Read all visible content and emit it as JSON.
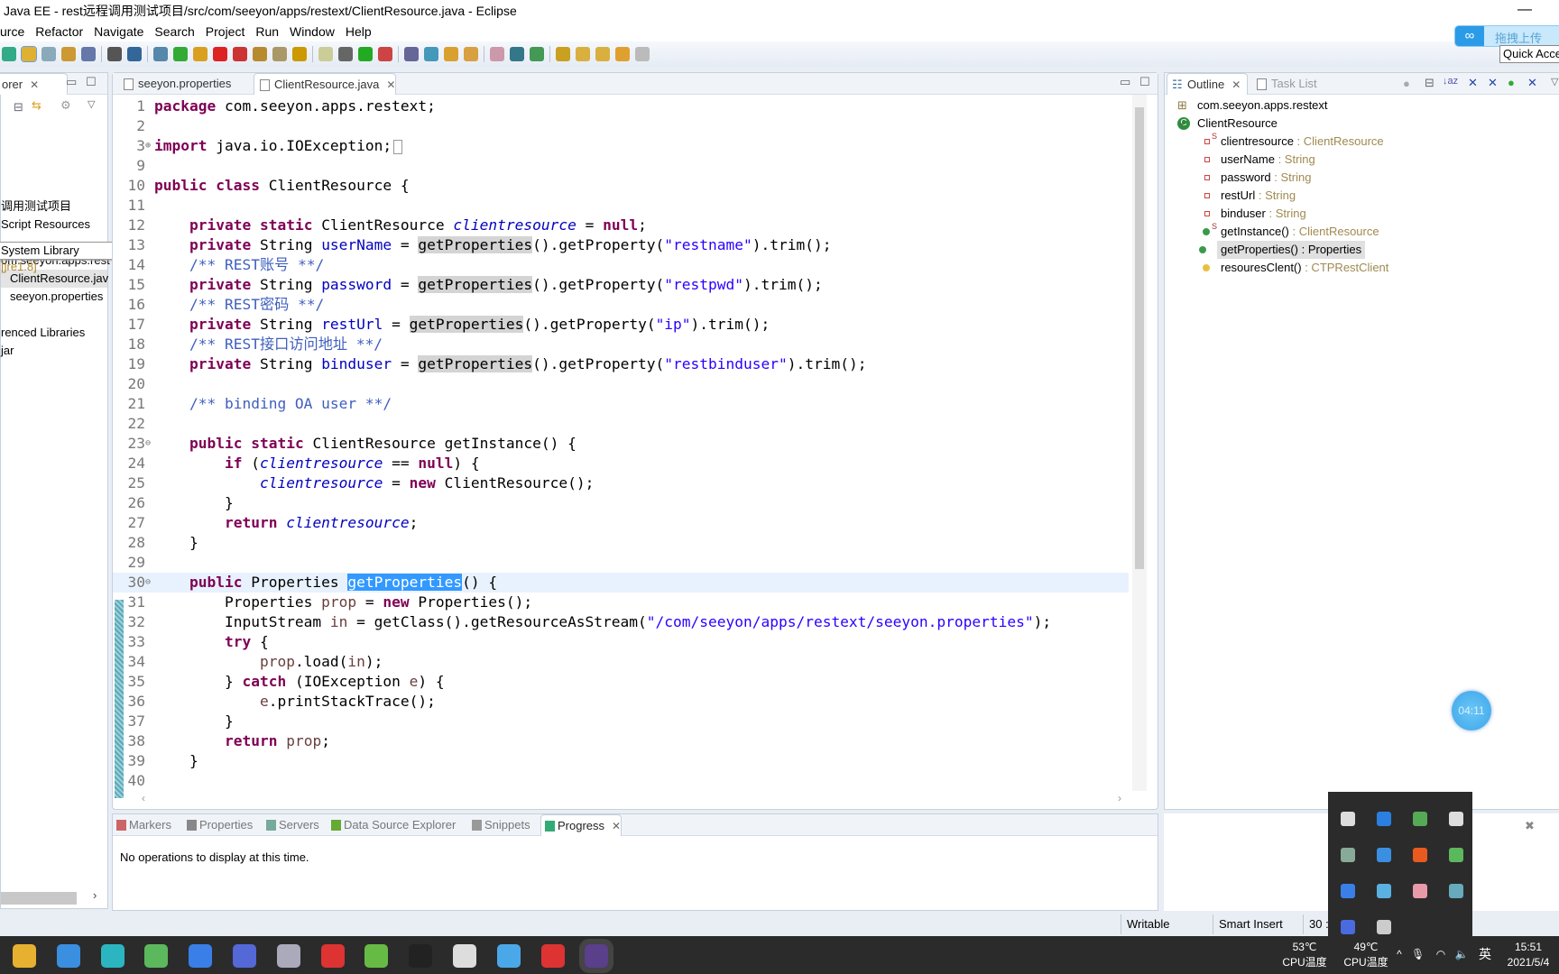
{
  "window": {
    "title": "Java EE - rest远程调用测试项目/src/com/seeyon/apps/restext/ClientResource.java - Eclipse",
    "minimize": "—"
  },
  "menu": [
    "urce",
    "Refactor",
    "Navigate",
    "Search",
    "Project",
    "Run",
    "Window",
    "Help"
  ],
  "toolbar_icons": [
    "pin-icon",
    "brush-icon",
    "link-icon",
    "doc-icon",
    "list-icon",
    "pilcrow-icon",
    "monitor-icon",
    "pen-icon",
    "resume-icon",
    "suspend-icon",
    "terminate-icon",
    "disconnect-icon",
    "step-into-icon",
    "step-over-icon",
    "step-return-icon",
    "drop-frame-icon",
    "bug-icon",
    "run-icon",
    "external-tools-icon",
    "new-server-icon",
    "new-class-icon",
    "open-folder-icon",
    "open-type-icon",
    "edit-icon",
    "globe-icon",
    "search-icon",
    "next-annotation-icon",
    "prev-annotation-icon",
    "last-edit-icon",
    "back-icon",
    "forward-icon"
  ],
  "toolbar_colors": [
    "#3a8",
    "#e0b030",
    "#8ab",
    "#c93",
    "#67a",
    "#555",
    "#369",
    "#58a",
    "#3a3",
    "#d9a020",
    "#d22",
    "#c33",
    "#b88a30",
    "#a96",
    "#c90",
    "#cc9",
    "#666",
    "#2a2",
    "#c44",
    "#669",
    "#49b",
    "#d9a030",
    "#d8a040",
    "#c9a",
    "#378",
    "#495",
    "#c9a020",
    "#d9b040",
    "#d9b040",
    "#e0a030",
    "#bbb"
  ],
  "baidu": {
    "label": "拖拽上传",
    "icon": "cloud-icon"
  },
  "quick_access": "Quick Acce",
  "explorer": {
    "tab": "orer",
    "items": [
      "调用测试项目",
      "Script Resources",
      "om.seeyon.apps.rest",
      "ClientResource.jav",
      "seeyon.properties",
      "System Library",
      "renced Libraries",
      "jar"
    ],
    "tooltip_main": "System Library",
    "tooltip_extra": "[jre1.8]"
  },
  "editor": {
    "tabs": [
      {
        "label": "seeyon.properties"
      },
      {
        "label": "ClientResource.java"
      }
    ],
    "lines": [
      {
        "n": "1",
        "t": [
          [
            "kw",
            "package"
          ],
          [
            "p",
            " com.seeyon.apps.restext;"
          ]
        ]
      },
      {
        "n": "2",
        "t": []
      },
      {
        "n": "3",
        "t": [
          [
            "kw",
            "import"
          ],
          [
            "p",
            " java.io.IOException;"
          ]
        ]
      },
      {
        "n": "9",
        "t": []
      },
      {
        "n": "10",
        "t": [
          [
            "kw",
            "public"
          ],
          [
            "p",
            " "
          ],
          [
            "kw",
            "class"
          ],
          [
            "p",
            " ClientResource {"
          ]
        ]
      },
      {
        "n": "11",
        "t": []
      },
      {
        "n": "12",
        "t": [
          [
            "p",
            "    "
          ],
          [
            "kw",
            "private"
          ],
          [
            "p",
            " "
          ],
          [
            "kw",
            "static"
          ],
          [
            "p",
            " ClientResource "
          ],
          [
            "sf",
            "clientresource"
          ],
          [
            "p",
            " = "
          ],
          [
            "kw",
            "null"
          ],
          [
            "p",
            ";"
          ]
        ]
      },
      {
        "n": "13",
        "t": [
          [
            "p",
            "    "
          ],
          [
            "kw",
            "private"
          ],
          [
            "p",
            " String "
          ],
          [
            "fd",
            "userName"
          ],
          [
            "p",
            " = "
          ],
          [
            "hl",
            "getProperties"
          ],
          [
            "p",
            "().getProperty("
          ],
          [
            "st",
            "\"restname\""
          ],
          [
            "p",
            ").trim();"
          ]
        ]
      },
      {
        "n": "14",
        "t": [
          [
            "cm",
            "    /** REST账号 **/"
          ]
        ]
      },
      {
        "n": "15",
        "t": [
          [
            "p",
            "    "
          ],
          [
            "kw",
            "private"
          ],
          [
            "p",
            " String "
          ],
          [
            "fd",
            "password"
          ],
          [
            "p",
            " = "
          ],
          [
            "hl",
            "getProperties"
          ],
          [
            "p",
            "().getProperty("
          ],
          [
            "st",
            "\"restpwd\""
          ],
          [
            "p",
            ").trim();"
          ]
        ]
      },
      {
        "n": "16",
        "t": [
          [
            "cm",
            "    /** REST密码 **/"
          ]
        ]
      },
      {
        "n": "17",
        "t": [
          [
            "p",
            "    "
          ],
          [
            "kw",
            "private"
          ],
          [
            "p",
            " String "
          ],
          [
            "fd",
            "restUrl"
          ],
          [
            "p",
            " = "
          ],
          [
            "hl",
            "getProperties"
          ],
          [
            "p",
            "().getProperty("
          ],
          [
            "st",
            "\"ip\""
          ],
          [
            "p",
            ").trim();"
          ]
        ]
      },
      {
        "n": "18",
        "t": [
          [
            "cm",
            "    /** REST接口访问地址 **/"
          ]
        ]
      },
      {
        "n": "19",
        "t": [
          [
            "p",
            "    "
          ],
          [
            "kw",
            "private"
          ],
          [
            "p",
            " String "
          ],
          [
            "fd",
            "binduser"
          ],
          [
            "p",
            " = "
          ],
          [
            "hl",
            "getProperties"
          ],
          [
            "p",
            "().getProperty("
          ],
          [
            "st",
            "\"restbinduser\""
          ],
          [
            "p",
            ").trim();"
          ]
        ]
      },
      {
        "n": "20",
        "t": []
      },
      {
        "n": "21",
        "t": [
          [
            "cm",
            "    /** binding OA user **/"
          ]
        ]
      },
      {
        "n": "22",
        "t": []
      },
      {
        "n": "23",
        "t": [
          [
            "p",
            "    "
          ],
          [
            "kw",
            "public"
          ],
          [
            "p",
            " "
          ],
          [
            "kw",
            "static"
          ],
          [
            "p",
            " ClientResource getInstance() {"
          ]
        ]
      },
      {
        "n": "24",
        "t": [
          [
            "p",
            "        "
          ],
          [
            "kw",
            "if"
          ],
          [
            "p",
            " ("
          ],
          [
            "sf",
            "clientresource"
          ],
          [
            "p",
            " == "
          ],
          [
            "kw",
            "null"
          ],
          [
            "p",
            ") {"
          ]
        ]
      },
      {
        "n": "25",
        "t": [
          [
            "p",
            "            "
          ],
          [
            "sf",
            "clientresource"
          ],
          [
            "p",
            " = "
          ],
          [
            "kw",
            "new"
          ],
          [
            "p",
            " ClientResource();"
          ]
        ]
      },
      {
        "n": "26",
        "t": [
          [
            "p",
            "        }"
          ]
        ]
      },
      {
        "n": "27",
        "t": [
          [
            "p",
            "        "
          ],
          [
            "kw",
            "return"
          ],
          [
            "p",
            " "
          ],
          [
            "sf",
            "clientresource"
          ],
          [
            "p",
            ";"
          ]
        ]
      },
      {
        "n": "28",
        "t": [
          [
            "p",
            "    }"
          ]
        ]
      },
      {
        "n": "29",
        "t": []
      },
      {
        "n": "30",
        "t": [
          [
            "p",
            "    "
          ],
          [
            "kw",
            "public"
          ],
          [
            "p",
            " Properties "
          ],
          [
            "sel",
            "getProperties"
          ],
          [
            "p",
            "() {"
          ]
        ]
      },
      {
        "n": "31",
        "t": [
          [
            "p",
            "        Properties "
          ],
          [
            "lv",
            "prop"
          ],
          [
            "p",
            " = "
          ],
          [
            "kw",
            "new"
          ],
          [
            "p",
            " Properties();"
          ]
        ]
      },
      {
        "n": "32",
        "t": [
          [
            "p",
            "        InputStream "
          ],
          [
            "lv",
            "in"
          ],
          [
            "p",
            " = getClass().getResourceAsStream("
          ],
          [
            "st",
            "\"/com/seeyon/apps/restext/seeyon.properties\""
          ],
          [
            "p",
            ");"
          ]
        ]
      },
      {
        "n": "33",
        "t": [
          [
            "p",
            "        "
          ],
          [
            "kw",
            "try"
          ],
          [
            "p",
            " {"
          ]
        ]
      },
      {
        "n": "34",
        "t": [
          [
            "p",
            "            "
          ],
          [
            "lv",
            "prop"
          ],
          [
            "p",
            ".load("
          ],
          [
            "lv",
            "in"
          ],
          [
            "p",
            ");"
          ]
        ]
      },
      {
        "n": "35",
        "t": [
          [
            "p",
            "        } "
          ],
          [
            "kw",
            "catch"
          ],
          [
            "p",
            " (IOException "
          ],
          [
            "lv",
            "e"
          ],
          [
            "p",
            ") {"
          ]
        ]
      },
      {
        "n": "36",
        "t": [
          [
            "p",
            "            "
          ],
          [
            "lv",
            "e"
          ],
          [
            "p",
            ".printStackTrace();"
          ]
        ]
      },
      {
        "n": "37",
        "t": [
          [
            "p",
            "        }"
          ]
        ]
      },
      {
        "n": "38",
        "t": [
          [
            "p",
            "        "
          ],
          [
            "kw",
            "return"
          ],
          [
            "p",
            " "
          ],
          [
            "lv",
            "prop"
          ],
          [
            "p",
            ";"
          ]
        ]
      },
      {
        "n": "39",
        "t": [
          [
            "p",
            "    }"
          ]
        ]
      },
      {
        "n": "40",
        "t": []
      }
    ],
    "current_line": "30"
  },
  "outline": {
    "tabs": [
      "Outline",
      "Task List"
    ],
    "items": [
      {
        "name": "com.seeyon.apps.restext",
        "type": "",
        "icon": "package-icon"
      },
      {
        "name": "ClientResource",
        "type": "",
        "icon": "class-icon"
      },
      {
        "name": "clientresource",
        "type": " : ClientResource",
        "icon": "private-field-icon",
        "static": "S"
      },
      {
        "name": "userName",
        "type": " : String",
        "icon": "private-field-icon"
      },
      {
        "name": "password",
        "type": " : String",
        "icon": "private-field-icon"
      },
      {
        "name": "restUrl",
        "type": " : String",
        "icon": "private-field-icon"
      },
      {
        "name": "binduser",
        "type": " : String",
        "icon": "private-field-icon"
      },
      {
        "name": "getInstance()",
        "type": " : ClientResource",
        "icon": "public-method-icon",
        "static": "S"
      },
      {
        "name": "getProperties()",
        "type": " : Properties",
        "icon": "public-method-icon",
        "selected": true
      },
      {
        "name": "resouresClent()",
        "type": " : CTPRestClient",
        "icon": "default-method-icon"
      }
    ]
  },
  "bottom": {
    "tabs": [
      "Markers",
      "Properties",
      "Servers",
      "Data Source Explorer",
      "Snippets",
      "Progress"
    ],
    "message": "No operations to display at this time."
  },
  "status": {
    "writable": "Writable",
    "insert": "Smart Insert",
    "position": "30 :"
  },
  "timer": "04:11",
  "taskbar": {
    "icons": [
      "file-explorer-icon",
      "mail-icon",
      "app-icon",
      "browser-icon",
      "feishu-icon",
      "gbox-icon",
      "photos-icon",
      "wps-icon",
      "notepad-icon",
      "terminal-icon",
      "settings-icon",
      "baidu-netdisk-icon",
      "video-icon",
      "eclipse-icon"
    ],
    "colors": [
      "#e8b030",
      "#3a8fe0",
      "#2bb5c0",
      "#5cb85c",
      "#3a7fe8",
      "#5468d8",
      "#aab",
      "#d33",
      "#6b4",
      "#222",
      "#ddd",
      "#4aa8e8",
      "#d33",
      "#5a3f8a"
    ],
    "cpu1_temp": "53℃",
    "cpu1_label": "CPU温度",
    "cpu2_temp": "49℃",
    "cpu2_label": "CPU温度",
    "ime": "英",
    "time": "15:51",
    "date": "2021/5/4"
  },
  "tray_icons": [
    "usb-icon",
    "bluetooth-icon",
    "nvidia-icon",
    "security-icon",
    "user-icon",
    "camera-icon",
    "office-icon",
    "browser-icon",
    "feishu-icon",
    "baidu-netdisk-icon",
    "flower-icon",
    "monitor-icon",
    "gbox-icon",
    "window-icon"
  ],
  "tray_colors": [
    "#ddd",
    "#2a7fe0",
    "#5a5",
    "#ddd",
    "#8a9",
    "#3a8fe0",
    "#e85a20",
    "#5cb85c",
    "#3a7fe8",
    "#5ab0e0",
    "#e89aa8",
    "#6ab",
    "#4a6ae0",
    "#ccc"
  ]
}
